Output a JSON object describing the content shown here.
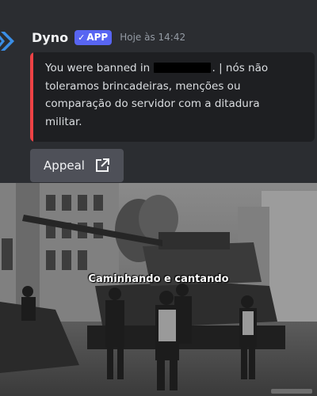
{
  "message": {
    "username": "Dyno",
    "badge_label": "APP",
    "badge_check": "✓",
    "timestamp": "Hoje às 14:42",
    "icon": "dyno-logo-icon"
  },
  "embed": {
    "text_before": "You were banned in",
    "text_after": ". | nós não toleramos brincadeiras, menções ou comparação do servidor com a ditadura militar.",
    "accent_color": "#ed4245"
  },
  "appeal": {
    "label": "Appeal",
    "icon": "external-link-icon"
  },
  "photo": {
    "caption": "Caminhando e cantando"
  },
  "colors": {
    "background": "#2b2d31",
    "embed_bg": "#1e1f22",
    "badge": "#5865f2",
    "button": "#4e5058",
    "timestamp": "#949ba4"
  }
}
